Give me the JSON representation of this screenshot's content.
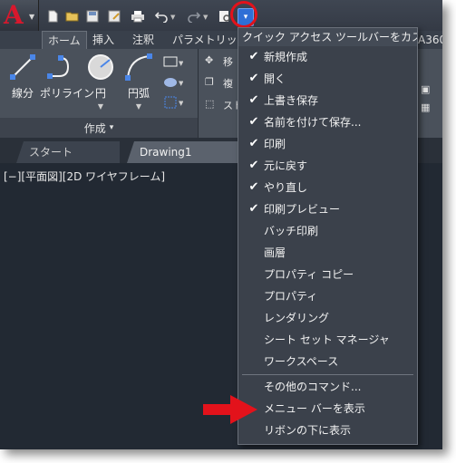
{
  "qat": {
    "icons": [
      "new-icon",
      "open-icon",
      "save-icon",
      "save-as-icon",
      "print-icon",
      "undo-icon",
      "redo-icon",
      "plot-preview-icon"
    ],
    "customize_glyph": "▾"
  },
  "ribbon_tabs": [
    "ホーム",
    "挿入",
    "注釈",
    "パラメトリック"
  ],
  "ribbon_tab_overflow": "A360",
  "ribbon": {
    "tools": [
      {
        "label": "線分"
      },
      {
        "label": "ポリライン"
      },
      {
        "label": "円"
      },
      {
        "label": "円弧"
      }
    ],
    "small_tools": [
      "移",
      "複",
      "スト"
    ],
    "panel_title": "作成",
    "panel_caret": "▾"
  },
  "file_tabs": [
    "スタート",
    "Drawing1"
  ],
  "viewport_label": "[−][平面図][2D ワイヤフレーム]",
  "menu": {
    "title": "クイック アクセス ツールバーをカスタマイズ",
    "items": [
      {
        "label": "新規作成",
        "checked": true
      },
      {
        "label": "開く",
        "checked": true
      },
      {
        "label": "上書き保存",
        "checked": true
      },
      {
        "label": "名前を付けて保存...",
        "checked": true
      },
      {
        "label": "印刷",
        "checked": true
      },
      {
        "label": "元に戻す",
        "checked": true
      },
      {
        "label": "やり直し",
        "checked": true
      },
      {
        "label": "印刷プレビュー",
        "checked": true
      },
      {
        "label": "バッチ印刷",
        "checked": false
      },
      {
        "label": "画層",
        "checked": false
      },
      {
        "label": "プロパティ コピー",
        "checked": false
      },
      {
        "label": "プロパティ",
        "checked": false
      },
      {
        "label": "レンダリング",
        "checked": false
      },
      {
        "label": "シート セット マネージャ",
        "checked": false
      },
      {
        "label": "ワークスペース",
        "checked": false
      }
    ],
    "more_commands": "その他のコマンド...",
    "show_menubar": "メニュー バーを表示",
    "show_below_ribbon": "リボンの下に表示"
  },
  "colors": {
    "accent_blue": "#2f6fd6",
    "annotation_red": "#e3121b",
    "autocad_red": "#d8182d"
  }
}
